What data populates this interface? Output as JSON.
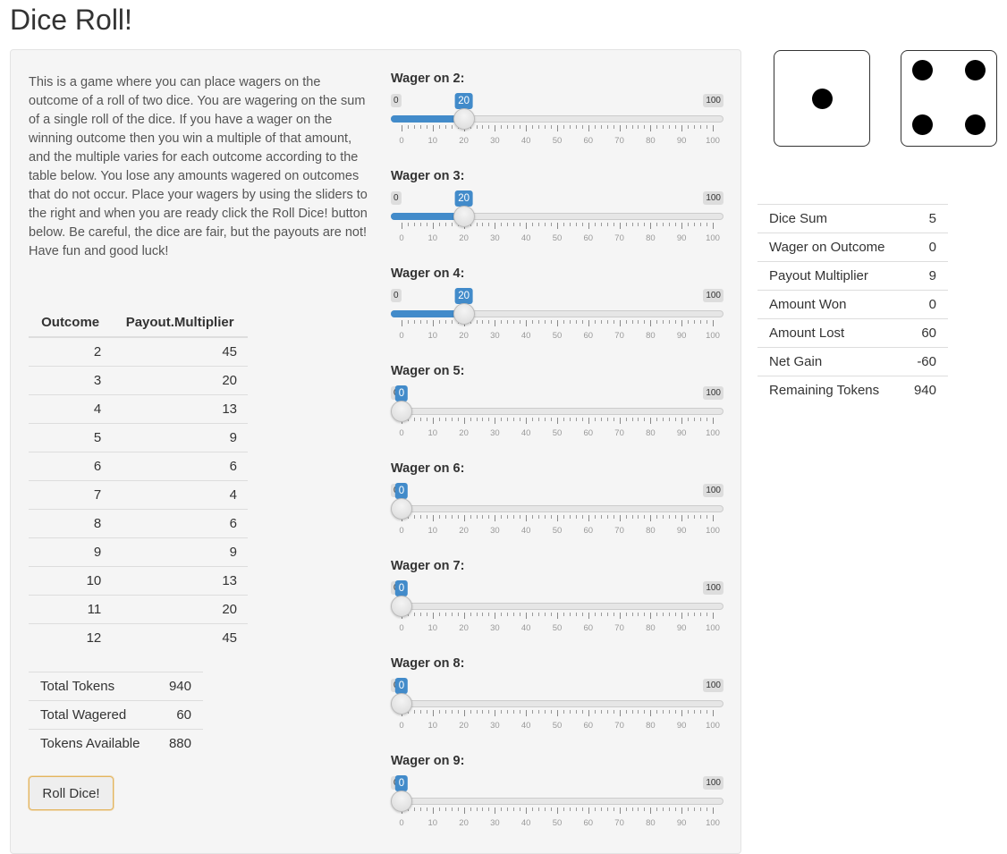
{
  "page_title": "Dice Roll!",
  "intro_text": "This is a game where you can place wagers on the outcome of a roll of two dice. You are wagering on the sum of a single roll of the dice. If you have a wager on the winning outcome then you win a multiple of that amount, and the multiple varies for each outcome according to the table below. You lose any amounts wagered on outcomes that do not occur. Place your wagers by using the sliders to the right and when you are ready click the Roll Dice! button below. Be careful, the dice are fair, but the payouts are not! Have fun and good luck!",
  "payout_table": {
    "headers": [
      "Outcome",
      "Payout.Multiplier"
    ],
    "rows": [
      [
        "2",
        "45"
      ],
      [
        "3",
        "20"
      ],
      [
        "4",
        "13"
      ],
      [
        "5",
        "9"
      ],
      [
        "6",
        "6"
      ],
      [
        "7",
        "4"
      ],
      [
        "8",
        "6"
      ],
      [
        "9",
        "9"
      ],
      [
        "10",
        "13"
      ],
      [
        "11",
        "20"
      ],
      [
        "12",
        "45"
      ]
    ]
  },
  "totals": [
    {
      "label": "Total Tokens",
      "value": "940"
    },
    {
      "label": "Total Wagered",
      "value": "60"
    },
    {
      "label": "Tokens Available",
      "value": "880"
    }
  ],
  "roll_button_label": "Roll Dice!",
  "slider_scale": {
    "min": 0,
    "max": 100,
    "tick_labels": [
      "0",
      "10",
      "20",
      "30",
      "40",
      "50",
      "60",
      "70",
      "80",
      "90",
      "100"
    ]
  },
  "sliders": [
    {
      "label": "Wager on 2:",
      "value": 20,
      "min_label": "0",
      "max_label": "100"
    },
    {
      "label": "Wager on 3:",
      "value": 20,
      "min_label": "0",
      "max_label": "100"
    },
    {
      "label": "Wager on 4:",
      "value": 20,
      "min_label": "0",
      "max_label": "100"
    },
    {
      "label": "Wager on 5:",
      "value": 0,
      "min_label": "0",
      "max_label": "100"
    },
    {
      "label": "Wager on 6:",
      "value": 0,
      "min_label": "0",
      "max_label": "100"
    },
    {
      "label": "Wager on 7:",
      "value": 0,
      "min_label": "0",
      "max_label": "100"
    },
    {
      "label": "Wager on 8:",
      "value": 0,
      "min_label": "0",
      "max_label": "100"
    },
    {
      "label": "Wager on 9:",
      "value": 0,
      "min_label": "0",
      "max_label": "100"
    }
  ],
  "dice": [
    {
      "face": 1
    },
    {
      "face": 4
    }
  ],
  "results": [
    {
      "label": "Dice Sum",
      "value": "5"
    },
    {
      "label": "Wager on Outcome",
      "value": "0"
    },
    {
      "label": "Payout Multiplier",
      "value": "9"
    },
    {
      "label": "Amount Won",
      "value": "0"
    },
    {
      "label": "Amount Lost",
      "value": "60"
    },
    {
      "label": "Net Gain",
      "value": "-60"
    },
    {
      "label": "Remaining Tokens",
      "value": "940"
    }
  ],
  "colors": {
    "accent": "#428bca",
    "button_focus": "#e3b55f"
  }
}
